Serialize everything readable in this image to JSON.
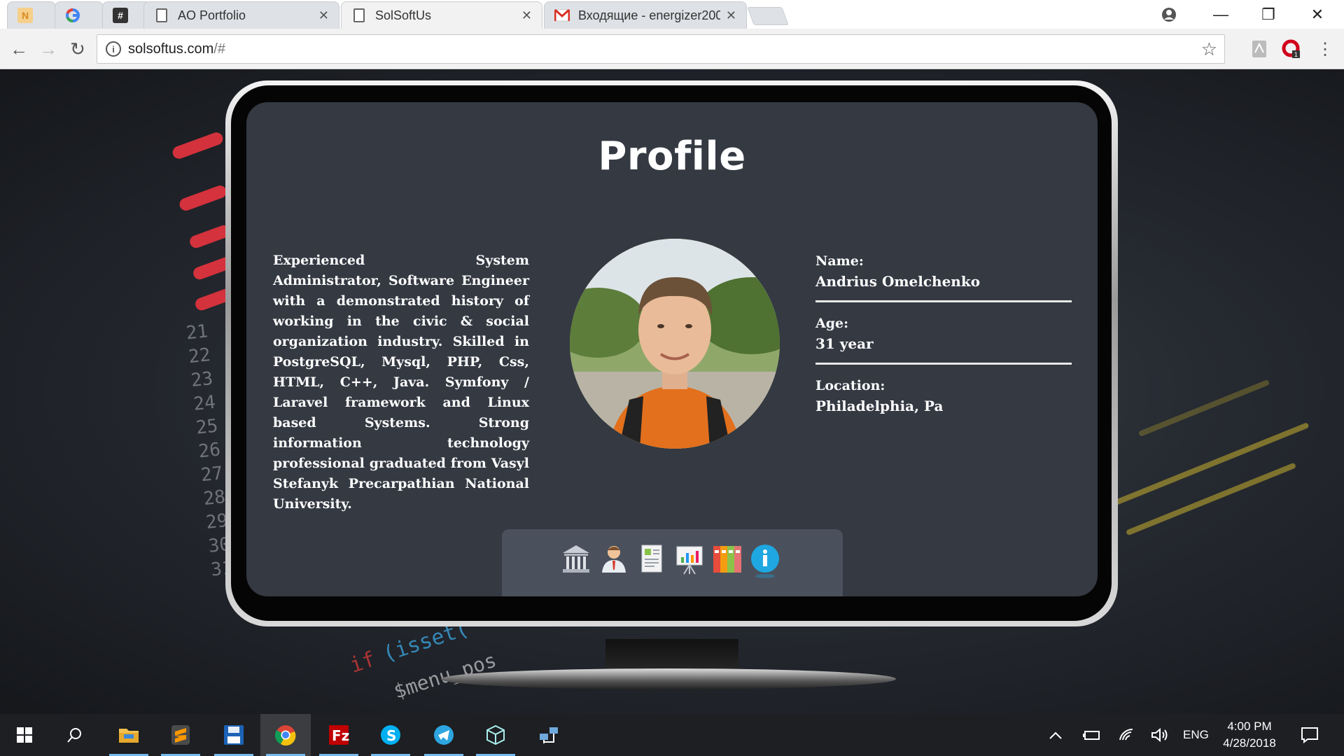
{
  "browser": {
    "tabs": [
      {
        "title": "",
        "favicon": "notion-like-icon"
      },
      {
        "title": "",
        "favicon": "google-icon"
      },
      {
        "title": "",
        "favicon": "slack-hash-icon"
      },
      {
        "title": "AO Portfolio",
        "favicon": "page-icon"
      },
      {
        "title": "SolSoftUs",
        "favicon": "page-icon"
      },
      {
        "title": "Входящие - energizer200",
        "favicon": "gmail-icon"
      }
    ],
    "url_host": "solsoftus.com",
    "url_rest": "/#"
  },
  "page": {
    "title": "Profile",
    "bio": "Experienced System Administrator, Software Engineer with a demonstrated history of working in the civic & social organization industry. Skilled in PostgreSQL, Mysql, PHP, Css, HTML, C++, Java. Symfony / Laravel framework and Linux based Systems. Strong information technology professional graduated from Vasyl Stefanyk Precarpathian National University.",
    "details": [
      {
        "label": "Name:",
        "value": "Andrius Omelchenko"
      },
      {
        "label": "Age:",
        "value": "31 year"
      },
      {
        "label": "Location:",
        "value": "Philadelphia, Pa"
      }
    ],
    "dock": [
      "bank-icon",
      "person-icon",
      "resume-icon",
      "presentation-chart-icon",
      "binders-icon",
      "info-icon"
    ]
  },
  "taskbar": {
    "language": "ENG",
    "time": "4:00 PM",
    "date": "4/28/2018"
  },
  "colors": {
    "screen": "#343942",
    "dock": "#4a515c",
    "taskbar": "#1d1f22"
  }
}
